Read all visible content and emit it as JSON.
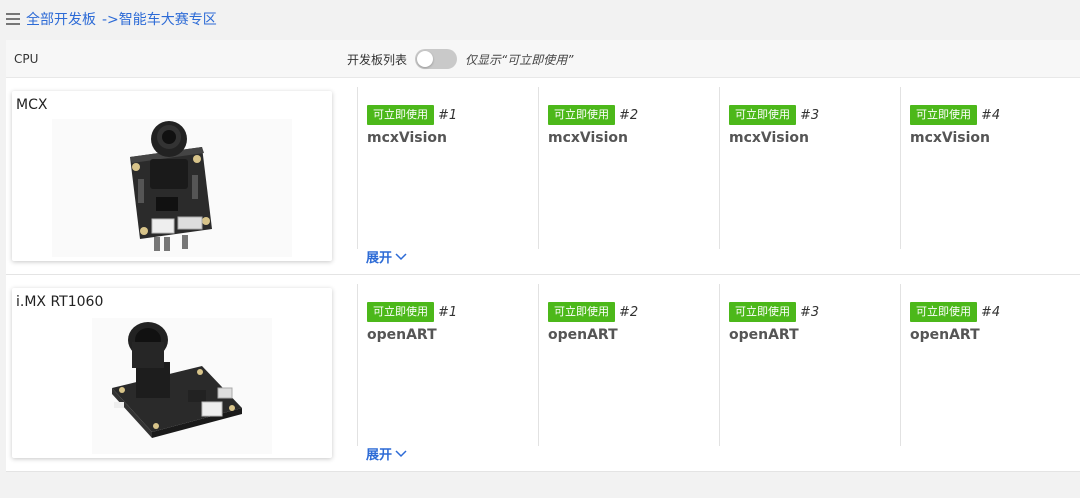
{
  "breadcrumb": {
    "root": "全部开发板",
    "current": "->智能车大赛专区"
  },
  "header": {
    "cpu_label": "CPU",
    "board_list_label": "开发板列表",
    "toggle_label": "仅显示“可立即使用”",
    "toggle_on": false
  },
  "rows": [
    {
      "cpu_name": "MCX",
      "expand_label": "展开",
      "boards": [
        {
          "status": "可立即使用",
          "index": "#1",
          "name": "mcxVision"
        },
        {
          "status": "可立即使用",
          "index": "#2",
          "name": "mcxVision"
        },
        {
          "status": "可立即使用",
          "index": "#3",
          "name": "mcxVision"
        },
        {
          "status": "可立即使用",
          "index": "#4",
          "name": "mcxVision"
        }
      ]
    },
    {
      "cpu_name": "i.MX RT1060",
      "expand_label": "展开",
      "boards": [
        {
          "status": "可立即使用",
          "index": "#1",
          "name": "openART"
        },
        {
          "status": "可立即使用",
          "index": "#2",
          "name": "openART"
        },
        {
          "status": "可立即使用",
          "index": "#3",
          "name": "openART"
        },
        {
          "status": "可立即使用",
          "index": "#4",
          "name": "openART"
        }
      ]
    }
  ],
  "colors": {
    "accent": "#2d6bd6",
    "status_green": "#4cb81a"
  }
}
